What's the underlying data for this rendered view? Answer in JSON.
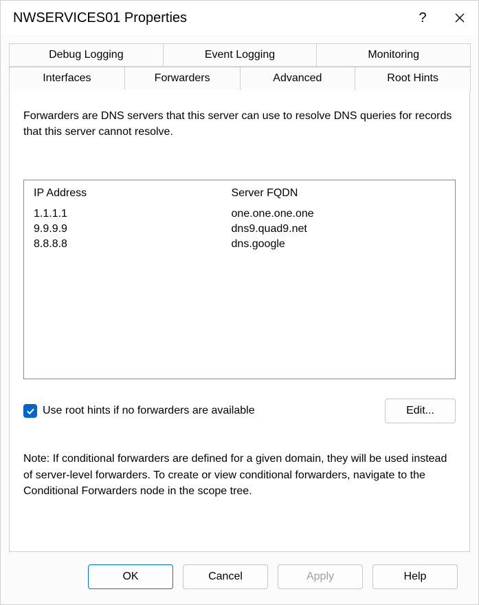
{
  "window": {
    "title": "NWSERVICES01 Properties"
  },
  "tabs": {
    "row1": [
      {
        "label": "Debug Logging"
      },
      {
        "label": "Event Logging"
      },
      {
        "label": "Monitoring"
      }
    ],
    "row2": [
      {
        "label": "Interfaces"
      },
      {
        "label": "Forwarders"
      },
      {
        "label": "Advanced"
      },
      {
        "label": "Root Hints"
      }
    ]
  },
  "panel": {
    "description": "Forwarders are DNS servers that this server can use to resolve DNS queries for records that this server cannot resolve.",
    "columns": {
      "ip": "IP Address",
      "fqdn": "Server FQDN"
    },
    "forwarders": [
      {
        "ip": "1.1.1.1",
        "fqdn": "one.one.one.one"
      },
      {
        "ip": "9.9.9.9",
        "fqdn": "dns9.quad9.net"
      },
      {
        "ip": "8.8.8.8",
        "fqdn": "dns.google"
      }
    ],
    "use_root_hints": {
      "checked": true,
      "label": "Use root hints if no forwarders are available"
    },
    "edit_button": "Edit...",
    "note": "Note: If conditional forwarders are defined for a given domain, they will be used instead of server-level forwarders.  To create or view conditional forwarders, navigate to the Conditional Forwarders node in the scope tree."
  },
  "buttons": {
    "ok": "OK",
    "cancel": "Cancel",
    "apply": "Apply",
    "help": "Help"
  }
}
